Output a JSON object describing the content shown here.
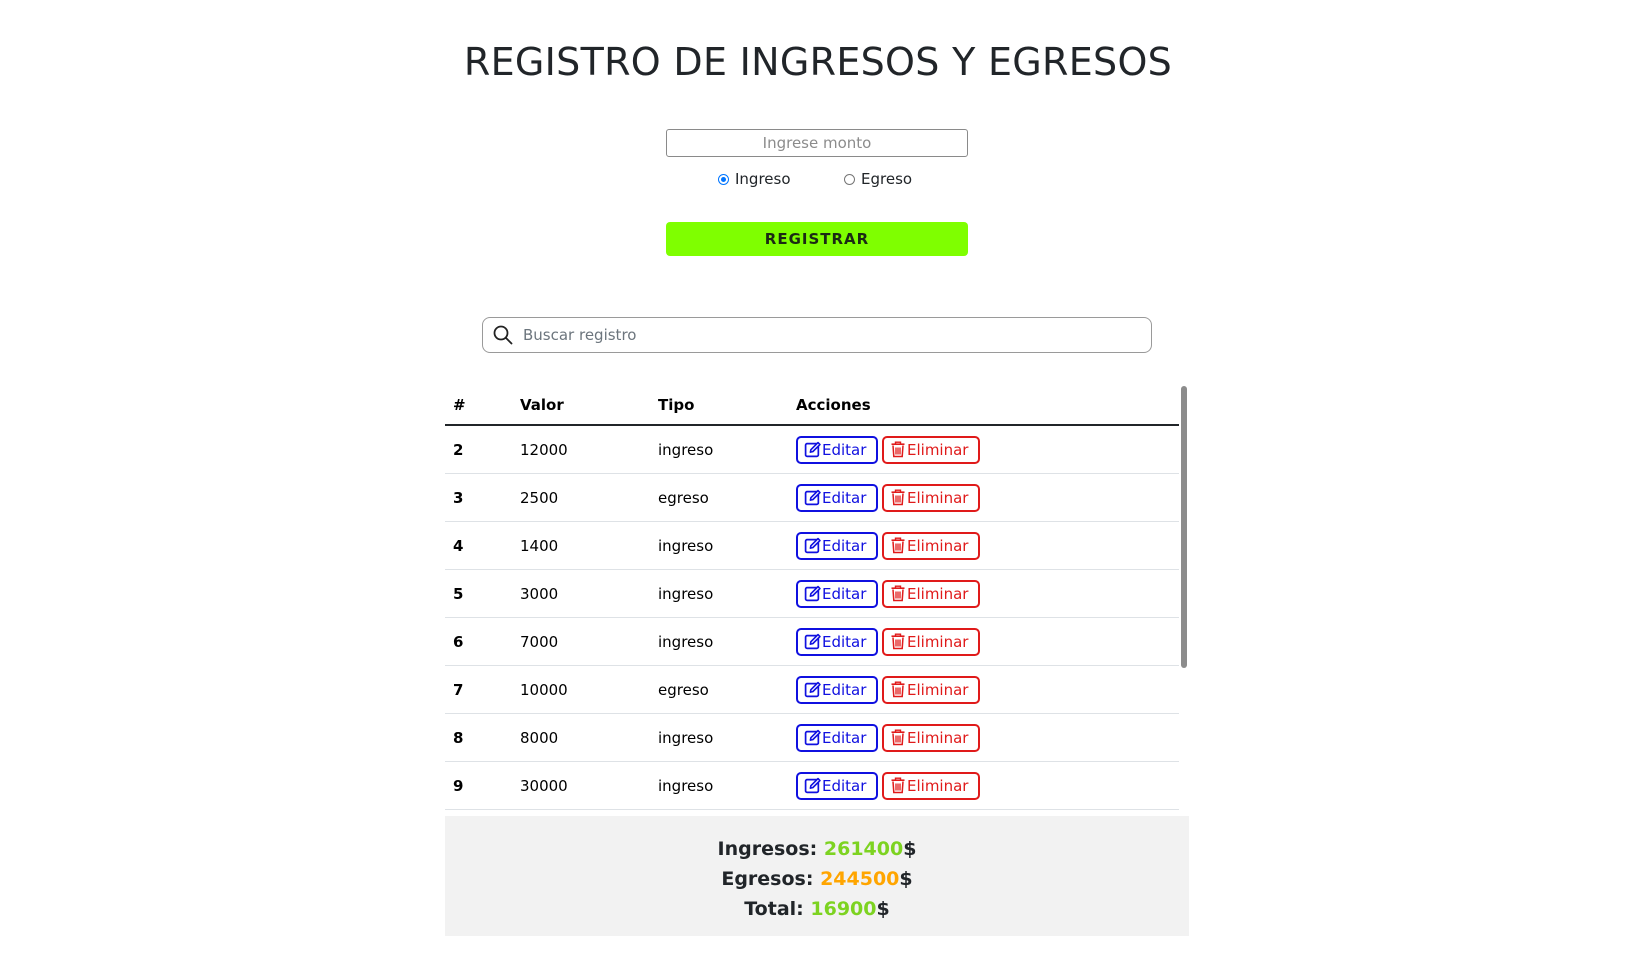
{
  "title": "REGISTRO DE INGRESOS Y EGRESOS",
  "form": {
    "amount_placeholder": "Ingrese monto",
    "amount_value": "",
    "radio_options": [
      {
        "label": "Ingreso",
        "checked": true
      },
      {
        "label": "Egreso",
        "checked": false
      }
    ],
    "register_label": "REGISTRAR",
    "register_color": "#7fff00"
  },
  "search": {
    "placeholder": "Buscar registro",
    "value": "",
    "icon": "search-icon"
  },
  "table": {
    "headers": {
      "num": "#",
      "valor": "Valor",
      "tipo": "Tipo",
      "acciones": "Acciones"
    },
    "edit_label": "Editar",
    "delete_label": "Eliminar",
    "edit_color": "#1010e0",
    "delete_color": "#e01a1a",
    "rows": [
      {
        "num": "2",
        "valor": "12000",
        "tipo": "ingreso"
      },
      {
        "num": "3",
        "valor": "2500",
        "tipo": "egreso"
      },
      {
        "num": "4",
        "valor": "1400",
        "tipo": "ingreso"
      },
      {
        "num": "5",
        "valor": "3000",
        "tipo": "ingreso"
      },
      {
        "num": "6",
        "valor": "7000",
        "tipo": "ingreso"
      },
      {
        "num": "7",
        "valor": "10000",
        "tipo": "egreso"
      },
      {
        "num": "8",
        "valor": "8000",
        "tipo": "ingreso"
      },
      {
        "num": "9",
        "valor": "30000",
        "tipo": "ingreso"
      }
    ]
  },
  "summary": {
    "ingresos_label": "Ingresos:",
    "ingresos_value": "261400",
    "egresos_label": "Egresos:",
    "egresos_value": "244500",
    "total_label": "Total:",
    "total_value": "16900",
    "currency": "$",
    "ingresos_color": "#7dd321",
    "egresos_color": "#ffa500",
    "total_color": "#7dd321"
  }
}
